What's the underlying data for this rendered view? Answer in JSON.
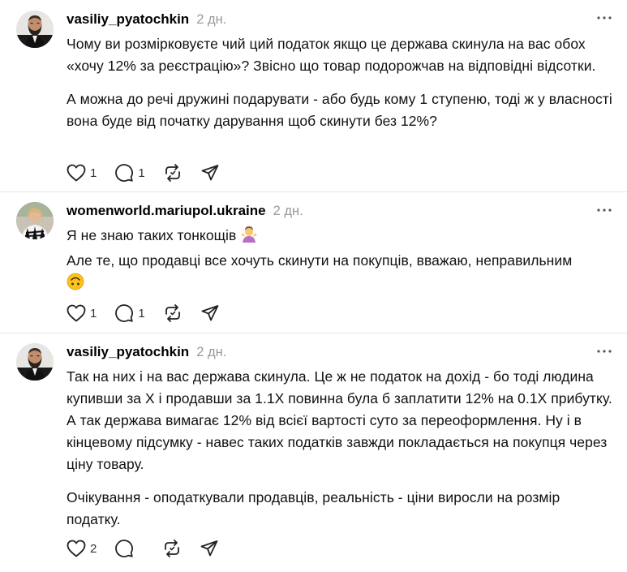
{
  "posts": [
    {
      "username": "vasiliy_pyatochkin",
      "time": "2 дн.",
      "paragraphs": [
        "Чому ви розмірковуєте чий ций податок якщо це держава скинула на вас обох «хочу 12% за реєстрацію»? Звісно що товар подорожчав на відповідні відсотки.",
        "А можна до речі дружині подарувати - або будь кому 1 ступеню, тоді ж у власності вона буде від початку дарування щоб скинути без 12%?"
      ],
      "likes": "1",
      "replies": "1",
      "avatar_icon": "bearded-man-avatar"
    },
    {
      "username": "womenworld.mariupol.ukraine",
      "time": "2 дн.",
      "line1": "Я не знаю таких тонкощів",
      "line1_emoji": "woman-shrugging-emoji",
      "line2": "Але те, що продавці все хочуть скинути на покупців, вважаю, неправильним",
      "line2_emoji": "upside-down-face-emoji",
      "likes": "1",
      "replies": "1",
      "avatar_icon": "woman-zebra-avatar"
    },
    {
      "username": "vasiliy_pyatochkin",
      "time": "2 дн.",
      "paragraphs": [
        "Так на них і на вас держава скинула. Це ж не податок на дохід - бо тоді людина купивши за Х і продавши за 1.1Х повинна була б заплатити 12% на 0.1Х прибутку. А так держава вимагає 12% від всієї вартості суто за переоформлення. Ну і в кінцевому підсумку - навес таких податків завжди покладається на покупця через ціну товару.",
        "Очікування - оподаткували продавців, реальність - ціни виросли на розмір податку."
      ],
      "likes": "2",
      "replies": "",
      "avatar_icon": "bearded-man-avatar"
    }
  ],
  "icons": {
    "like": "heart-icon",
    "reply": "comment-bubble-icon",
    "repost": "repost-icon",
    "share": "send-icon",
    "more": "more-dots-icon"
  },
  "colors": {
    "text": "#000000",
    "muted": "#9a9a9a",
    "divider": "#e5e5e5"
  }
}
